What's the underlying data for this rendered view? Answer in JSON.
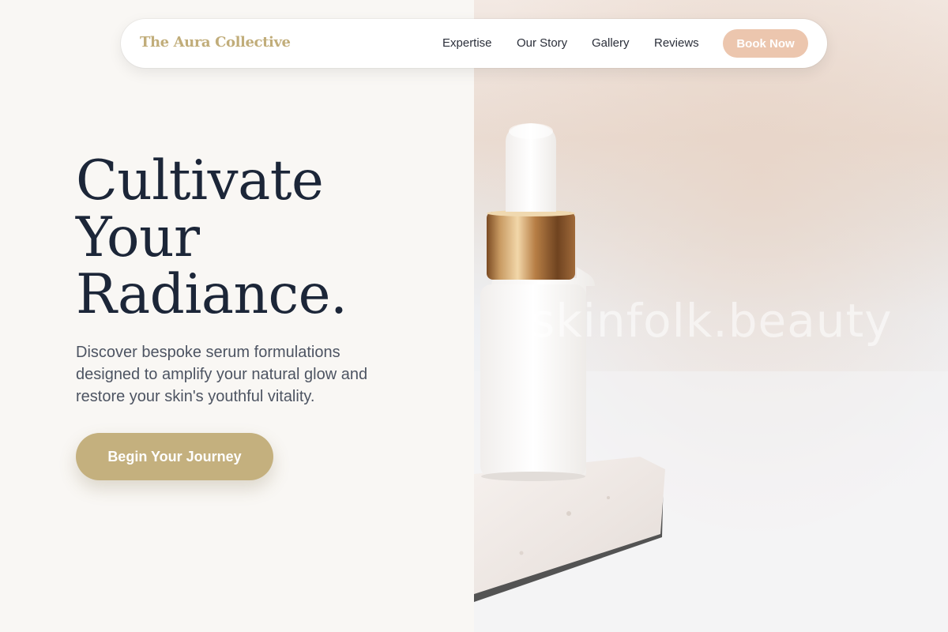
{
  "nav": {
    "brand": "The Aura Collective",
    "links": [
      "Expertise",
      "Our Story",
      "Gallery",
      "Reviews"
    ],
    "cta": "Book Now"
  },
  "hero": {
    "headline": [
      "Cultivate",
      "Your",
      "Radiance."
    ],
    "subtext": "Discover bespoke serum formulations designed to amplify your natural glow and restore your skin's youthful vitality.",
    "cta": "Begin Your Journey",
    "image_watermark": "skinfolk.beauty"
  },
  "colors": {
    "accent_gold": "#c4b07e",
    "accent_peach": "#ecc6ae",
    "heading": "#1c2638",
    "body_text": "#4d5462",
    "background": "#f9f7f4"
  }
}
